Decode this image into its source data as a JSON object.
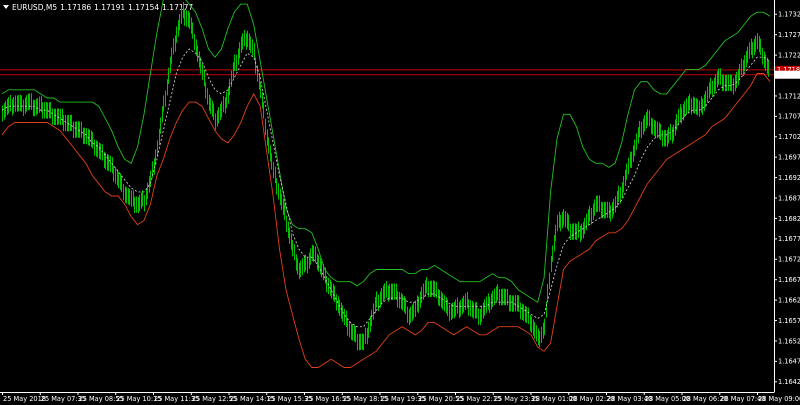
{
  "header": {
    "symbol": "EURUSD,M5",
    "open": "1.17186",
    "high": "1.17191",
    "low": "1.17154",
    "close": "1.17177"
  },
  "colors": {
    "background": "#000000",
    "candles": "#00c000",
    "upper_band": "#22c022",
    "lower_band": "#e0401a",
    "middle_band": "#c8c8c8",
    "price_lines": "#c00000",
    "axes_text": "#ffffff"
  },
  "chart_data": {
    "type": "line",
    "title": "",
    "indicator": "Bollinger Bands",
    "ylim": [
      1.164,
      1.1736
    ],
    "y_ticks": [
      "1.17325",
      "1.17275",
      "1.17225",
      "1.17175",
      "1.17125",
      "1.17075",
      "1.17025",
      "1.16975",
      "1.16925",
      "1.16875",
      "1.16825",
      "1.16775",
      "1.16725",
      "1.16675",
      "1.16625",
      "1.16575",
      "1.16525",
      "1.16475",
      "1.16425"
    ],
    "x_ticks": [
      "25 May 2018",
      "25 May 07:35",
      "25 May 08:55",
      "25 May 10:15",
      "25 May 11:35",
      "25 May 12:55",
      "25 May 14:15",
      "25 May 15:35",
      "25 May 16:55",
      "25 May 18:15",
      "25 May 19:35",
      "25 May 20:55",
      "25 May 22:15",
      "25 May 23:35",
      "28 May 01:00",
      "28 May 02:20",
      "28 May 03:40",
      "28 May 05:00",
      "28 May 06:20",
      "28 May 07:40",
      "28 May 09:00"
    ],
    "ask_label": "1.17189",
    "bid_label": "1.17177",
    "ask_line": 1.17189,
    "bid_line": 1.17177,
    "price_series": [
      1.1709,
      1.171,
      1.1711,
      1.171,
      1.1711,
      1.171,
      1.171,
      1.1709,
      1.1708,
      1.1707,
      1.1706,
      1.1705,
      1.1704,
      1.1703,
      1.1701,
      1.1699,
      1.1697,
      1.1695,
      1.1692,
      1.1689,
      1.1687,
      1.1686,
      1.1687,
      1.1692,
      1.17,
      1.171,
      1.172,
      1.1728,
      1.1733,
      1.1731,
      1.1725,
      1.1718,
      1.1711,
      1.1707,
      1.1709,
      1.1713,
      1.172,
      1.1725,
      1.1727,
      1.1723,
      1.1714,
      1.1703,
      1.1694,
      1.1688,
      1.1682,
      1.1675,
      1.167,
      1.1671,
      1.1674,
      1.1672,
      1.1668,
      1.1665,
      1.1662,
      1.1658,
      1.1655,
      1.1653,
      1.1652,
      1.1657,
      1.1662,
      1.1664,
      1.1665,
      1.1664,
      1.1662,
      1.1659,
      1.166,
      1.1664,
      1.1666,
      1.1665,
      1.1663,
      1.166,
      1.166,
      1.1661,
      1.1662,
      1.166,
      1.1659,
      1.1661,
      1.1663,
      1.1664,
      1.1663,
      1.1662,
      1.1661,
      1.1659,
      1.1657,
      1.1653,
      1.1656,
      1.1672,
      1.1681,
      1.1683,
      1.168,
      1.1679,
      1.168,
      1.1683,
      1.1686,
      1.1685,
      1.1684,
      1.1686,
      1.169,
      1.1695,
      1.17,
      1.1705,
      1.1707,
      1.1705,
      1.1703,
      1.1702,
      1.1704,
      1.1708,
      1.171,
      1.1711,
      1.1709,
      1.1712,
      1.1715,
      1.1717,
      1.1716,
      1.1715,
      1.1717,
      1.1721,
      1.1724,
      1.1726,
      1.1722,
      1.1718
    ],
    "upper_band": [
      1.1713,
      1.1714,
      1.1714,
      1.1714,
      1.1714,
      1.1714,
      1.1713,
      1.1712,
      1.1712,
      1.1711,
      1.1711,
      1.1711,
      1.1711,
      1.1711,
      1.1711,
      1.171,
      1.1707,
      1.1704,
      1.17,
      1.1697,
      1.1696,
      1.17,
      1.1708,
      1.1718,
      1.1728,
      1.1736,
      1.1738,
      1.1739,
      1.1737,
      1.1735,
      1.1733,
      1.1729,
      1.1724,
      1.1722,
      1.1724,
      1.1729,
      1.1733,
      1.1735,
      1.1735,
      1.173,
      1.1721,
      1.1712,
      1.1703,
      1.1694,
      1.1685,
      1.1681,
      1.168,
      1.168,
      1.1679,
      1.1675,
      1.167,
      1.1668,
      1.1667,
      1.1667,
      1.1667,
      1.1666,
      1.1667,
      1.1669,
      1.167,
      1.167,
      1.167,
      1.167,
      1.167,
      1.1669,
      1.1669,
      1.167,
      1.167,
      1.1671,
      1.167,
      1.1669,
      1.1668,
      1.1667,
      1.1667,
      1.1667,
      1.1667,
      1.1668,
      1.1669,
      1.1668,
      1.1668,
      1.1667,
      1.1665,
      1.1664,
      1.1663,
      1.1662,
      1.1668,
      1.1689,
      1.1702,
      1.1708,
      1.1708,
      1.1705,
      1.17,
      1.1697,
      1.1696,
      1.1696,
      1.1695,
      1.1696,
      1.1701,
      1.1708,
      1.1714,
      1.1716,
      1.1716,
      1.1714,
      1.1713,
      1.1713,
      1.1715,
      1.1717,
      1.1719,
      1.1719,
      1.1719,
      1.172,
      1.1722,
      1.1724,
      1.1726,
      1.1727,
      1.1728,
      1.173,
      1.1732,
      1.1733,
      1.1733,
      1.1732
    ],
    "middle_band": [
      1.1709,
      1.171,
      1.171,
      1.171,
      1.171,
      1.171,
      1.1709,
      1.1709,
      1.1708,
      1.1707,
      1.1706,
      1.1705,
      1.1704,
      1.1703,
      1.1701,
      1.17,
      1.1698,
      1.1696,
      1.1694,
      1.1692,
      1.169,
      1.1689,
      1.1689,
      1.1691,
      1.1697,
      1.1704,
      1.1711,
      1.1718,
      1.1722,
      1.1724,
      1.1723,
      1.1721,
      1.1717,
      1.1714,
      1.1713,
      1.1714,
      1.1717,
      1.172,
      1.1723,
      1.1722,
      1.1717,
      1.1709,
      1.1701,
      1.1693,
      1.1686,
      1.1679,
      1.1675,
      1.1673,
      1.1673,
      1.1671,
      1.1668,
      1.1665,
      1.1662,
      1.1659,
      1.1657,
      1.1656,
      1.1656,
      1.1658,
      1.166,
      1.1662,
      1.1663,
      1.1663,
      1.1663,
      1.1662,
      1.1662,
      1.1663,
      1.1664,
      1.1664,
      1.1663,
      1.1662,
      1.1661,
      1.1661,
      1.1661,
      1.1661,
      1.1661,
      1.1661,
      1.1662,
      1.1662,
      1.1662,
      1.1662,
      1.1661,
      1.166,
      1.1659,
      1.1658,
      1.1659,
      1.1665,
      1.1671,
      1.1676,
      1.1678,
      1.1679,
      1.168,
      1.1681,
      1.1682,
      1.1683,
      1.1684,
      1.1685,
      1.1687,
      1.169,
      1.1693,
      1.1697,
      1.17,
      1.1702,
      1.1703,
      1.1703,
      1.1704,
      1.1706,
      1.1708,
      1.1709,
      1.1709,
      1.171,
      1.1712,
      1.1714,
      1.1715,
      1.1715,
      1.1716,
      1.1718,
      1.172,
      1.1722,
      1.1722,
      1.1721
    ],
    "lower_band": [
      1.1703,
      1.1705,
      1.1706,
      1.1706,
      1.1706,
      1.1706,
      1.1706,
      1.1706,
      1.1705,
      1.1704,
      1.1702,
      1.17,
      1.1698,
      1.1696,
      1.1693,
      1.1691,
      1.1689,
      1.1688,
      1.1688,
      1.1686,
      1.1683,
      1.1681,
      1.1682,
      1.1686,
      1.1693,
      1.1697,
      1.1702,
      1.1706,
      1.1709,
      1.1711,
      1.1711,
      1.171,
      1.1707,
      1.1704,
      1.1702,
      1.1701,
      1.1703,
      1.1706,
      1.171,
      1.1713,
      1.171,
      1.1699,
      1.1688,
      1.1675,
      1.1665,
      1.1659,
      1.1653,
      1.1648,
      1.1646,
      1.1646,
      1.1647,
      1.1648,
      1.1647,
      1.1646,
      1.1646,
      1.1647,
      1.1648,
      1.1649,
      1.165,
      1.1652,
      1.1654,
      1.1655,
      1.1656,
      1.1655,
      1.1654,
      1.1655,
      1.1657,
      1.1657,
      1.1656,
      1.1655,
      1.1654,
      1.1655,
      1.1656,
      1.1655,
      1.1654,
      1.1654,
      1.1655,
      1.1656,
      1.1656,
      1.1656,
      1.1656,
      1.1655,
      1.1654,
      1.1651,
      1.165,
      1.1652,
      1.1661,
      1.167,
      1.1672,
      1.1673,
      1.1674,
      1.1675,
      1.1677,
      1.1678,
      1.1679,
      1.1679,
      1.168,
      1.1682,
      1.1685,
      1.1688,
      1.1691,
      1.1693,
      1.1695,
      1.1697,
      1.1698,
      1.1699,
      1.17,
      1.1701,
      1.1702,
      1.1703,
      1.1705,
      1.1706,
      1.1707,
      1.1709,
      1.1711,
      1.1713,
      1.1715,
      1.1718,
      1.1718,
      1.1716
    ]
  }
}
